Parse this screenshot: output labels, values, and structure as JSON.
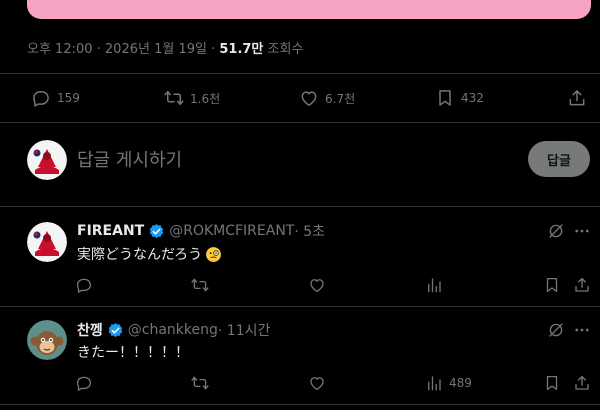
{
  "post": {
    "meta_prefix": "오후 12:00 · 2026년 1월 19일 · ",
    "views_count": "51.7만",
    "views_label": " 조회수",
    "stats": {
      "replies": "159",
      "reposts": "1.6천",
      "likes": "6.7천",
      "bookmarks": "432"
    }
  },
  "compose": {
    "placeholder": "답글 게시하기",
    "reply_button": "답글"
  },
  "replies": [
    {
      "name": "FIREANT",
      "handle": "@ROKMCFIREANT",
      "time": " · 5초",
      "text": "実際どうなんだろう",
      "views": ""
    },
    {
      "name": "찬껭",
      "handle": "@chankkeng",
      "time": " · 11시간",
      "text": "きたー！！！！！",
      "views": "489"
    }
  ],
  "colors": {
    "background": "#000000",
    "divider": "#2f3336",
    "muted": "#71767b",
    "verified": "#1d9bf0",
    "media_pink": "#f7a4c4"
  }
}
